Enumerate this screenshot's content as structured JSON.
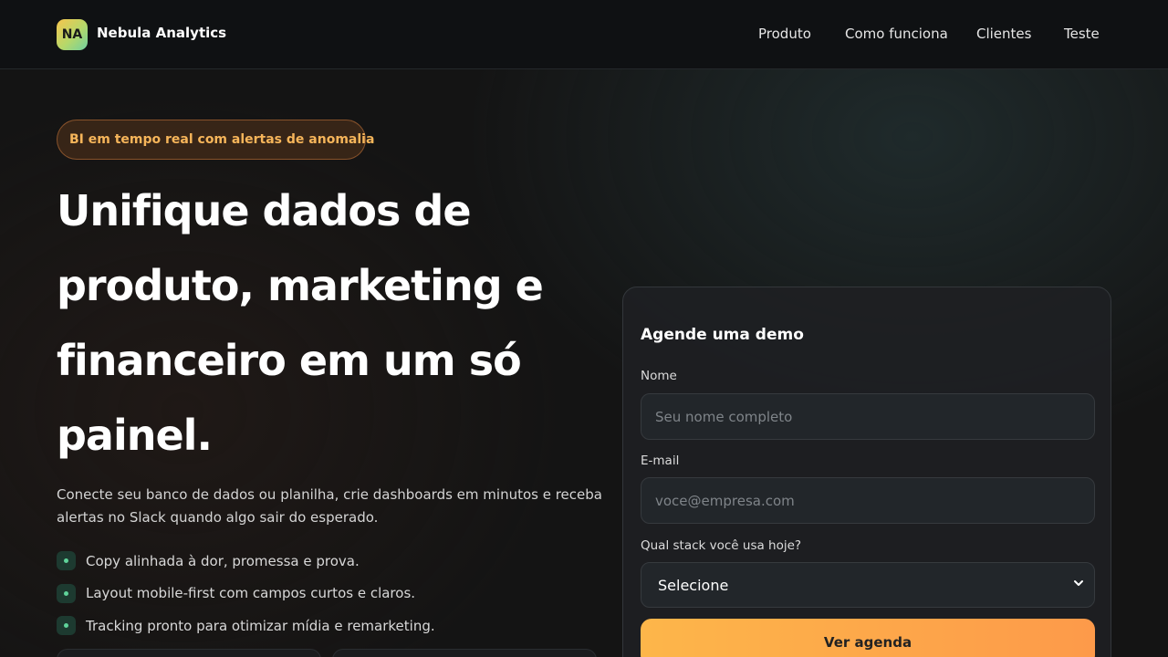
{
  "header": {
    "logo_initials": "NA",
    "brand_name": "Nebula Analytics",
    "nav": [
      "Produto",
      "Como funciona",
      "Clientes",
      "Teste"
    ]
  },
  "hero": {
    "badge": "BI em tempo real com alertas de anomalia",
    "headline": "Unifique dados de produto, marketing e financeiro em um só painel.",
    "subtitle": "Conecte seu banco de dados ou planilha, crie dashboards em minutos e receba alertas no Slack quando algo sair do esperado.",
    "bullets": [
      "Copy alinhada à dor, promessa e prova.",
      "Layout mobile-first com campos curtos e claros.",
      "Tracking pronto para otimizar mídia e remarketing."
    ]
  },
  "form": {
    "title": "Agende uma demo",
    "name_label": "Nome",
    "name_placeholder": "Seu nome completo",
    "email_label": "E-mail",
    "email_placeholder": "voce@empresa.com",
    "stack_label": "Qual stack você usa hoje?",
    "stack_selected": "Selecione",
    "submit_label": "Ver agenda"
  },
  "colors": {
    "accent": "#fdb64a",
    "badge_text": "#f6b55a",
    "bullet_dot": "#5fd39a"
  }
}
